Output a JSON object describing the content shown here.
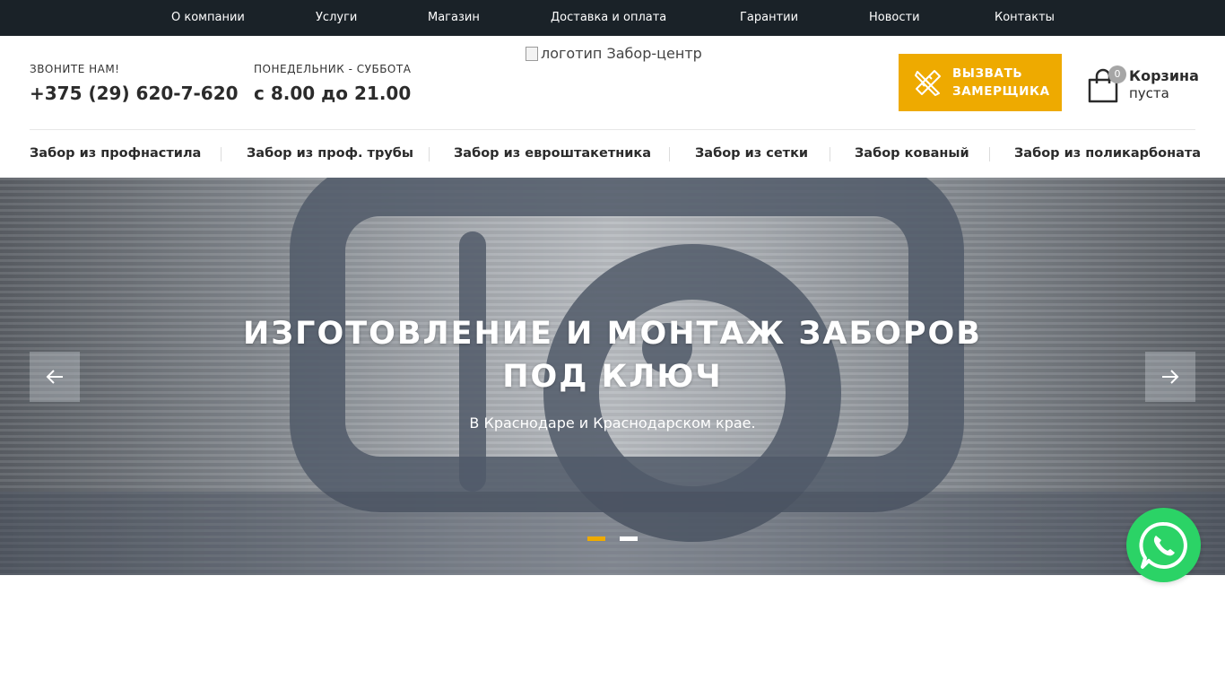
{
  "topnav": {
    "items": [
      "О компании",
      "Услуги",
      "Магазин",
      "Доставка и оплата",
      "Гарантии",
      "Новости",
      "Контакты"
    ]
  },
  "header": {
    "phone_label": "ЗВОНИТЕ НАМ!",
    "phone": "+375 (29) 620-7-620",
    "hours_label": "ПОНЕДЕЛЬНИК - СУББОТА",
    "hours": "с 8.00 до 21.00",
    "logo_alt": "логотип Забор-центр",
    "call_button": "ВЫЗВАТЬ ЗАМЕРЩИКА",
    "call_icon": "ruler-pencil-icon",
    "cart": {
      "title": "Корзина",
      "status": "пуста",
      "count": "0",
      "icon": "shopping-bag-icon"
    }
  },
  "catnav": {
    "items": [
      "Забор из профнастила",
      "Забор из проф. трубы",
      "Забор из евроштакетника",
      "Забор из сетки",
      "Забор кованый",
      "Забор из поликарбоната"
    ]
  },
  "hero": {
    "title": "ИЗГОТОВЛЕНИЕ И МОНТАЖ ЗАБОРОВ ПОД КЛЮЧ",
    "subtitle": "В Краснодаре и Краснодарском крае.",
    "prev_icon": "arrow-left-icon",
    "next_icon": "arrow-right-icon",
    "slide_count": 2,
    "active_slide": 1
  },
  "whatsapp": {
    "icon": "whatsapp-icon"
  },
  "colors": {
    "topbar": "#1a2228",
    "accent": "#eeaa00",
    "text": "#2b2b2b",
    "whatsapp": "#2bd366"
  }
}
